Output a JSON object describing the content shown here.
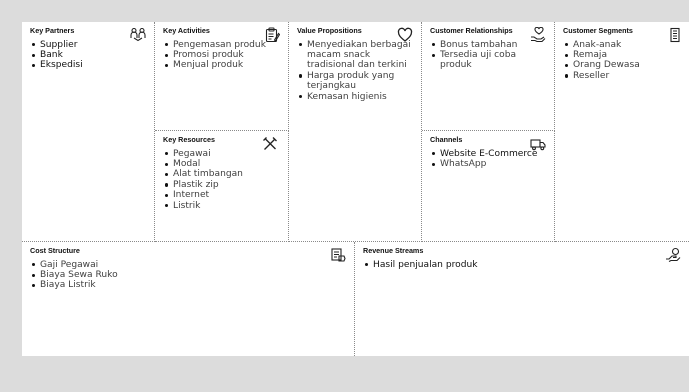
{
  "canvas": {
    "key_partners": {
      "title": "Key Partners",
      "icon": "handshake-icon",
      "items": [
        "Supplier",
        "Bank",
        "Ekspedisi"
      ]
    },
    "key_activities": {
      "title": "Key Activities",
      "icon": "clipboard-icon",
      "items": [
        "Pengemasan produk",
        "Promosi produk",
        "Menjual produk"
      ]
    },
    "key_resources": {
      "title": "Key Resources",
      "icon": "tools-icon",
      "items": [
        "Pegawai",
        "Modal",
        "Alat timbangan",
        "Plastik zip",
        "Internet",
        "Listrik"
      ]
    },
    "value_propositions": {
      "title": "Value Propositions",
      "icon": "heart-icon",
      "items": [
        "Menyediakan berbagai macam snack tradisional dan terkini",
        "Harga produk yang terjangkau",
        "Kemasan higienis"
      ]
    },
    "customer_relationships": {
      "title": "Customer Relationships",
      "icon": "heart-hand-icon",
      "items": [
        "Bonus tambahan",
        "Tersedia uji coba produk"
      ]
    },
    "channels": {
      "title": "Channels",
      "icon": "delivery-truck-icon",
      "items": [
        "Website E-Commerce",
        "WhatsApp"
      ]
    },
    "customer_segments": {
      "title": "Customer Segments",
      "icon": "building-icon",
      "items": [
        "Anak-anak",
        "Remaja",
        "Orang Dewasa",
        "Reseller"
      ]
    },
    "cost_structure": {
      "title": "Cost Structure",
      "icon": "price-tag-icon",
      "items": [
        "Gaji Pegawai",
        "Biaya Sewa Ruko",
        "Biaya Listrik"
      ]
    },
    "revenue_streams": {
      "title": "Revenue Streams",
      "icon": "money-hand-icon",
      "items": [
        "Hasil penjualan produk"
      ]
    }
  }
}
